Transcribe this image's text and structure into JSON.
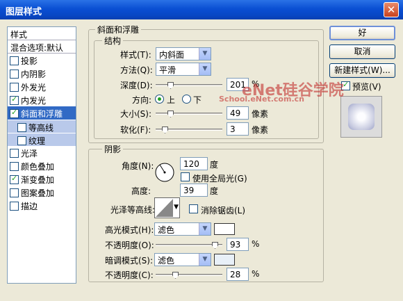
{
  "window": {
    "title": "图层样式",
    "close_glyph": "✕"
  },
  "styles_panel": {
    "header": "样式",
    "blend_options": "混合选项:默认",
    "items": [
      {
        "label": "投影",
        "checked": false
      },
      {
        "label": "内阴影",
        "checked": false
      },
      {
        "label": "外发光",
        "checked": false
      },
      {
        "label": "内发光",
        "checked": true
      },
      {
        "label": "斜面和浮雕",
        "checked": true,
        "selected": true
      },
      {
        "label": "等高线",
        "checked": false,
        "sub": true
      },
      {
        "label": "纹理",
        "checked": false,
        "sub": true
      },
      {
        "label": "光泽",
        "checked": false
      },
      {
        "label": "颜色叠加",
        "checked": false
      },
      {
        "label": "渐变叠加",
        "checked": true
      },
      {
        "label": "图案叠加",
        "checked": false
      },
      {
        "label": "描边",
        "checked": false
      }
    ]
  },
  "bevel": {
    "group_title": "斜面和浮雕",
    "structure_title": "结构",
    "style_label": "样式(T):",
    "style_value": "内斜面",
    "method_label": "方法(Q):",
    "method_value": "平滑",
    "depth_label": "深度(D):",
    "depth_value": "201",
    "depth_unit": "%",
    "direction_label": "方向:",
    "direction_up": "上",
    "direction_down": "下",
    "size_label": "大小(S):",
    "size_value": "49",
    "size_unit": "像素",
    "soften_label": "软化(F):",
    "soften_value": "3",
    "soften_unit": "像素",
    "depth_level": 0.2,
    "size_level": 0.2,
    "soften_level": 0.1
  },
  "shading": {
    "group_title": "阴影",
    "angle_label": "角度(N):",
    "angle_value": "120",
    "angle_unit": "度",
    "global_light_label": "使用全局光(G)",
    "altitude_label": "高度:",
    "altitude_value": "39",
    "altitude_unit": "度",
    "gloss_label": "光泽等高线:",
    "antialias_label": "消除锯齿(L)",
    "highlight_mode_label": "高光模式(H):",
    "highlight_mode_value": "滤色",
    "highlight_opacity_label": "不透明度(O):",
    "highlight_opacity_value": "93",
    "highlight_opacity_unit": "%",
    "shadow_mode_label": "暗调模式(S):",
    "shadow_mode_value": "滤色",
    "shadow_opacity_label": "不透明度(C):",
    "shadow_opacity_value": "28",
    "shadow_opacity_unit": "%",
    "highlight_color": "#ffffff",
    "shadow_color": "#e8f0f8",
    "highlight_opacity_level": 0.93,
    "shadow_opacity_level": 0.28
  },
  "buttons": {
    "ok": "好",
    "cancel": "取消",
    "new_style": "新建样式(W)...",
    "preview": "预览(V)"
  },
  "watermark": {
    "line1": "eNet硅谷学院",
    "line2": "School.eNet.com.cn"
  }
}
